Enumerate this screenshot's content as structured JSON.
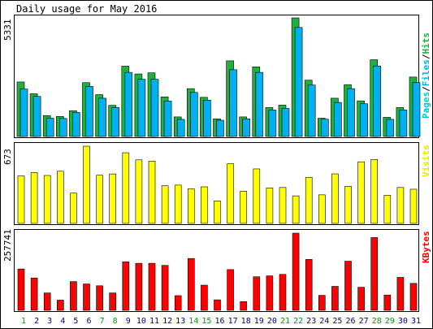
{
  "header": {
    "title": "Daily usage for May 2016"
  },
  "legend": {
    "pages": "Pages",
    "sep1": "/",
    "files": "Files",
    "sep2": "/",
    "hits": "Hits",
    "visits": "Visits",
    "kbytes": "KBytes"
  },
  "colors": {
    "hits": "#20b040",
    "files": "#00b0f0",
    "pages": "#00c8c8",
    "visits": "#ffff00",
    "kbytes": "#ff0000",
    "weekend_label": "#00a000",
    "weekday_label": "#000080",
    "frame": "#000000"
  },
  "chart_data": [
    {
      "type": "bar",
      "name": "hits-files-pages",
      "ymax_label": "5331",
      "ylim": [
        0,
        5331
      ],
      "categories": [
        "1",
        "2",
        "3",
        "4",
        "5",
        "6",
        "7",
        "8",
        "9",
        "10",
        "11",
        "12",
        "13",
        "14",
        "15",
        "16",
        "17",
        "18",
        "19",
        "20",
        "21",
        "22",
        "23",
        "24",
        "25",
        "26",
        "27",
        "28",
        "29",
        "30",
        "31"
      ],
      "weekend": [
        1,
        7,
        8,
        14,
        15,
        21,
        22,
        28,
        29
      ],
      "series": [
        {
          "name": "Hits",
          "values": [
            2450,
            1920,
            940,
            900,
            1160,
            2420,
            1880,
            1400,
            3160,
            2810,
            2860,
            1780,
            880,
            2150,
            1760,
            790,
            3400,
            880,
            3130,
            1300,
            1410,
            5331,
            2530,
            820,
            1720,
            2330,
            1600,
            3450,
            860,
            1300,
            2670
          ]
        },
        {
          "name": "Files",
          "values": [
            2130,
            1800,
            820,
            810,
            1080,
            2250,
            1720,
            1300,
            2880,
            2570,
            2570,
            1590,
            770,
            1980,
            1630,
            730,
            3000,
            790,
            2880,
            1190,
            1260,
            4900,
            2310,
            780,
            1530,
            2150,
            1470,
            3170,
            770,
            1190,
            2420
          ]
        },
        {
          "name": "Pages",
          "values": [
            0,
            0,
            0,
            0,
            0,
            0,
            0,
            0,
            0,
            0,
            0,
            0,
            0,
            0,
            0,
            0,
            0,
            0,
            0,
            0,
            0,
            0,
            0,
            0,
            0,
            0,
            0,
            0,
            0,
            0,
            0
          ]
        }
      ]
    },
    {
      "type": "bar",
      "name": "visits",
      "ymax_label": "673",
      "ylim": [
        0,
        673
      ],
      "categories": [
        "1",
        "2",
        "3",
        "4",
        "5",
        "6",
        "7",
        "8",
        "9",
        "10",
        "11",
        "12",
        "13",
        "14",
        "15",
        "16",
        "17",
        "18",
        "19",
        "20",
        "21",
        "22",
        "23",
        "24",
        "25",
        "26",
        "27",
        "28",
        "29",
        "30",
        "31"
      ],
      "series": [
        {
          "name": "Visits",
          "values": [
            414,
            443,
            418,
            455,
            264,
            673,
            420,
            431,
            616,
            554,
            543,
            328,
            334,
            302,
            319,
            196,
            520,
            281,
            475,
            309,
            313,
            240,
            402,
            249,
            432,
            323,
            537,
            557,
            246,
            313,
            298
          ]
        }
      ]
    },
    {
      "type": "bar",
      "name": "kbytes",
      "ymax_label": "257741",
      "ylim": [
        0,
        257741
      ],
      "categories": [
        "1",
        "2",
        "3",
        "4",
        "5",
        "6",
        "7",
        "8",
        "9",
        "10",
        "11",
        "12",
        "13",
        "14",
        "15",
        "16",
        "17",
        "18",
        "19",
        "20",
        "21",
        "22",
        "23",
        "24",
        "25",
        "26",
        "27",
        "28",
        "29",
        "30",
        "31"
      ],
      "series": [
        {
          "name": "KBytes",
          "values": [
            138000,
            108000,
            58000,
            34000,
            96000,
            88000,
            82000,
            58000,
            162000,
            157000,
            157000,
            150000,
            49000,
            173000,
            84000,
            35000,
            136000,
            29000,
            112000,
            115000,
            120000,
            257741,
            170000,
            50000,
            80000,
            164000,
            77000,
            243000,
            51000,
            110000,
            90000
          ]
        }
      ]
    }
  ]
}
